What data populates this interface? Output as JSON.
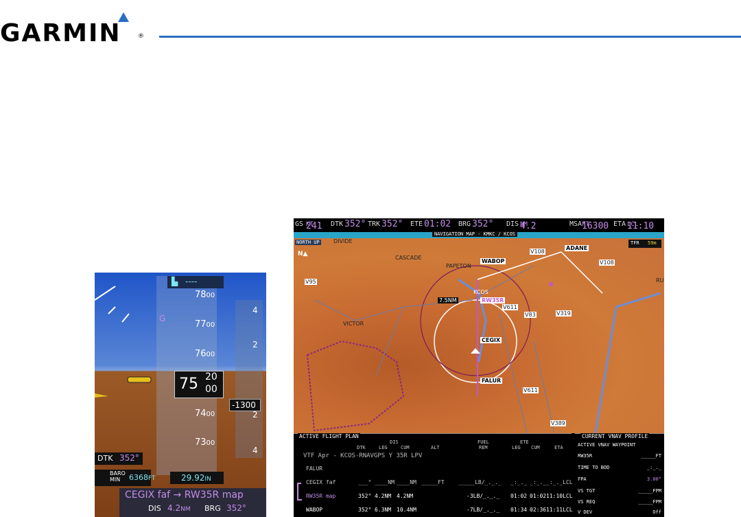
{
  "brand": {
    "name": "GARMIN",
    "reg": "®",
    "color_blue": "#2a6dc2"
  },
  "pfd": {
    "alt_tape_top": "----",
    "alt_ticks": [
      {
        "main": "78",
        "small": "00"
      },
      {
        "main": "77",
        "small": "00"
      },
      {
        "main": "76",
        "small": "00"
      },
      {
        "main": "74",
        "small": "00"
      },
      {
        "main": "73",
        "small": "00"
      }
    ],
    "alt_current": {
      "main": "75",
      "top": "20",
      "bottom": "00"
    },
    "vs_ticks": [
      "4",
      "2",
      "2",
      "4"
    ],
    "vs_readout": "-1300",
    "glideslope_label": "G",
    "dtk_label": "DTK",
    "dtk_value": "352°",
    "baro_label_1": "BARO",
    "baro_label_2": "MIN",
    "baro_value": "6368",
    "baro_unit": "FT",
    "altimeter_setting": "29.92",
    "altimeter_unit": "IN",
    "nav_leg": "CEGIX faf → RW35R map",
    "dis_label": "DIS",
    "dis_value": "4.2",
    "dis_unit": "NM",
    "brg_label": "BRG",
    "brg_value": "352°"
  },
  "mfd": {
    "databar": {
      "gs_label": "GS",
      "gs_value": "241",
      "gs_unit": "KT",
      "dtk_label": "DTK",
      "dtk_value": "352°",
      "trk_label": "TRK",
      "trk_value": "352°",
      "ete_label": "ETE",
      "ete_value": "01:02",
      "brg_label": "BRG",
      "brg_value": "352°",
      "dis_label": "DIS",
      "dis_value": "4.2",
      "dis_unit": "NM",
      "msa_label": "MSA",
      "msa_value": "16300",
      "msa_unit": "FT",
      "eta_label": "ETA",
      "eta_value": "11:10",
      "eta_unit": "LCL"
    },
    "map_title": "NAVIGATION MAP - KMKC / KCOS",
    "north_up": "NORTH UP",
    "tfr_label": "TFR",
    "tfr_value": "59m",
    "map_labels": {
      "divide": "DIVIDE",
      "cascade": "CASCADE",
      "papeton": "PAPETON",
      "victor": "VICTOR",
      "kcos": "KCOS",
      "range": "7.5NM",
      "v108a": "V108",
      "v108b": "V108",
      "v95": "V95",
      "v611a": "V611",
      "v83": "V83",
      "v319": "V319",
      "v611b": "V611",
      "v389": "V389",
      "ru": "RU"
    },
    "waypoints": {
      "adane": "ADANE",
      "wabop": "WABOP",
      "rw35r": "RW35R",
      "cegix": "CEGIX",
      "falur": "FALUR"
    },
    "fpl": {
      "title": "ACTIVE FLIGHT PLAN",
      "headers": {
        "dis": "DIS",
        "dtk": "DTK",
        "leg": "LEG",
        "cum": "CUM",
        "alt": "ALT",
        "fuel": "FUEL",
        "rem": "REM",
        "ete": "ETE",
        "ete_leg": "LEG",
        "ete_cum": "CUM",
        "eta": "ETA"
      },
      "procedure": "VTF Apr - KCOS-RNAVGPS Y 35R LPV",
      "rows": [
        {
          "name": "FALUR",
          "dtk": "",
          "leg": "",
          "cum": "",
          "alt": "",
          "fuel": "",
          "ete_leg": "",
          "ete_cum": "",
          "eta": ""
        },
        {
          "name": "CEGIX faf",
          "dtk": "___°",
          "leg": "____NM",
          "cum": "____NM",
          "alt": "_____FT",
          "fuel": "_____LB/_._._",
          "ete_leg": "_:_._",
          "ete_cum": "_:_._",
          "eta": "_:_._LCL"
        },
        {
          "name": "RW35R map",
          "dtk": "352°",
          "leg": "4.2NM",
          "cum": "4.2NM",
          "alt": "",
          "fuel": "-3LB/_._._",
          "ete_leg": "01:02",
          "ete_cum": "01:02",
          "eta": "11:10LCL"
        },
        {
          "name": "WABOP",
          "dtk": "352°",
          "leg": "6.3NM",
          "cum": "10.4NM",
          "alt": "",
          "fuel": "-7LB/_._._",
          "ete_leg": "01:34",
          "ete_cum": "02:36",
          "eta": "11:11LCL"
        }
      ]
    },
    "vnav": {
      "title": "CURRENT VNAV PROFILE",
      "rows": [
        {
          "label": "ACTIVE VNAV WAYPOINT",
          "value": ""
        },
        {
          "label": "RW35R",
          "value": "_____FT"
        },
        {
          "label": "TIME TO BOD",
          "value": "_:_._"
        },
        {
          "label": "FPA",
          "value": "3.00°"
        },
        {
          "label": "VS TGT",
          "value": "_____FPM"
        },
        {
          "label": "VS REQ",
          "value": "_____FPM"
        },
        {
          "label": "V DEV",
          "value": "Off"
        }
      ]
    }
  }
}
